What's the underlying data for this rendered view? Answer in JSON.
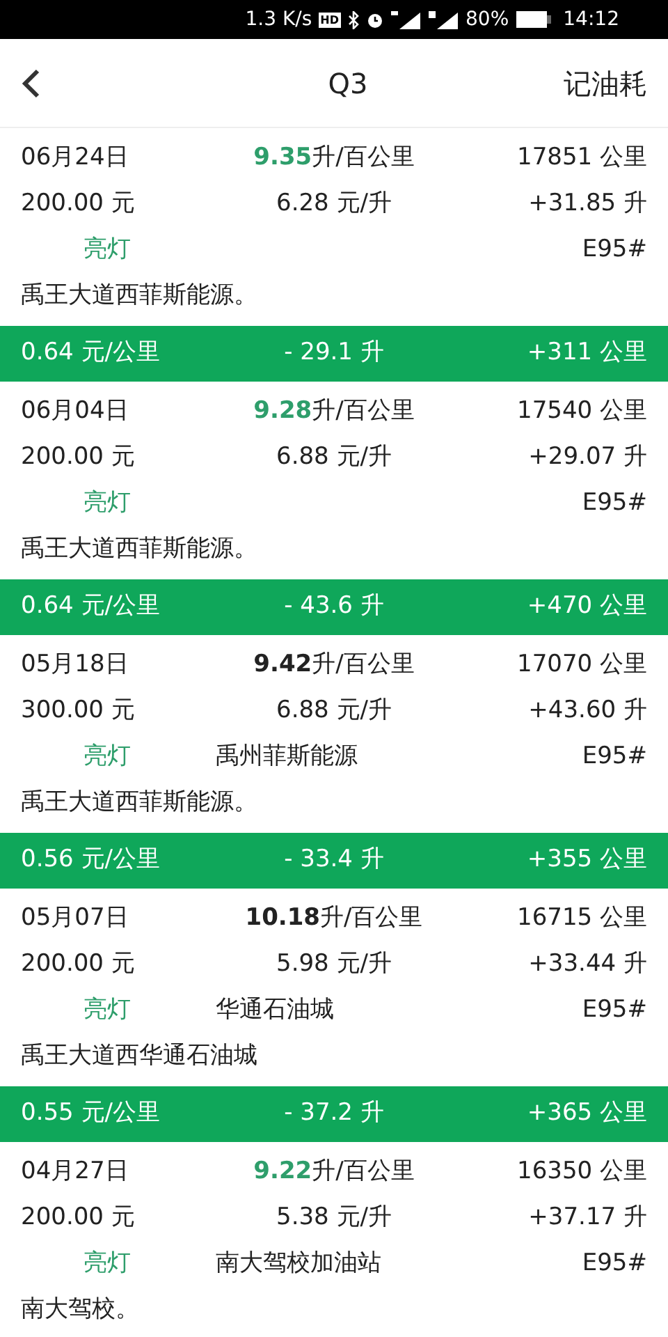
{
  "status_bar": {
    "speed": "1.3 K/s",
    "hd": "HD",
    "battery": "80%",
    "time": "14:12"
  },
  "header": {
    "title": "Q3",
    "action": "记油耗"
  },
  "entries": [
    {
      "date": "06月24日",
      "efficiency": "9.35",
      "efficiency_unit": "升/百公里",
      "efficient": true,
      "odometer": "17851 公里",
      "amount": "200.00 元",
      "price": "6.28 元/升",
      "fuel": "+31.85 升",
      "light": "亮灯",
      "grade": "E95#",
      "note": "禹王大道西菲斯能源。",
      "summary": {
        "cost_per_km": "0.64 元/公里",
        "fuel_delta": "- 29.1 升",
        "distance": "+311 公里"
      }
    },
    {
      "date": "06月04日",
      "efficiency": "9.28",
      "efficiency_unit": "升/百公里",
      "efficient": true,
      "odometer": "17540 公里",
      "amount": "200.00 元",
      "price": "6.88 元/升",
      "fuel": "+29.07 升",
      "light": "亮灯",
      "grade": "E95#",
      "note": "禹王大道西菲斯能源。",
      "summary": {
        "cost_per_km": "0.64 元/公里",
        "fuel_delta": "- 43.6 升",
        "distance": "+470 公里"
      }
    },
    {
      "date": "05月18日",
      "efficiency": "9.42",
      "efficiency_unit": "升/百公里",
      "efficient": false,
      "odometer": "17070 公里",
      "amount": "300.00 元",
      "price": "6.88 元/升",
      "fuel": "+43.60 升",
      "light": "亮灯",
      "station": "禹州菲斯能源",
      "grade": "E95#",
      "note": "禹王大道西菲斯能源。",
      "summary": {
        "cost_per_km": "0.56 元/公里",
        "fuel_delta": "- 33.4 升",
        "distance": "+355 公里"
      }
    },
    {
      "date": "05月07日",
      "efficiency": "10.18",
      "efficiency_unit": "升/百公里",
      "efficient": false,
      "odometer": "16715 公里",
      "amount": "200.00 元",
      "price": "5.98 元/升",
      "fuel": "+33.44 升",
      "light": "亮灯",
      "station": "华通石油城",
      "grade": "E95#",
      "note": "禹王大道西华通石油城",
      "summary": {
        "cost_per_km": "0.55 元/公里",
        "fuel_delta": "- 37.2 升",
        "distance": "+365 公里"
      }
    },
    {
      "date": "04月27日",
      "efficiency": "9.22",
      "efficiency_unit": "升/百公里",
      "efficient": true,
      "odometer": "16350 公里",
      "amount": "200.00 元",
      "price": "5.38 元/升",
      "fuel": "+37.17 升",
      "light": "亮灯",
      "station": "南大驾校加油站",
      "grade": "E95#",
      "note": "南大驾校。"
    }
  ]
}
